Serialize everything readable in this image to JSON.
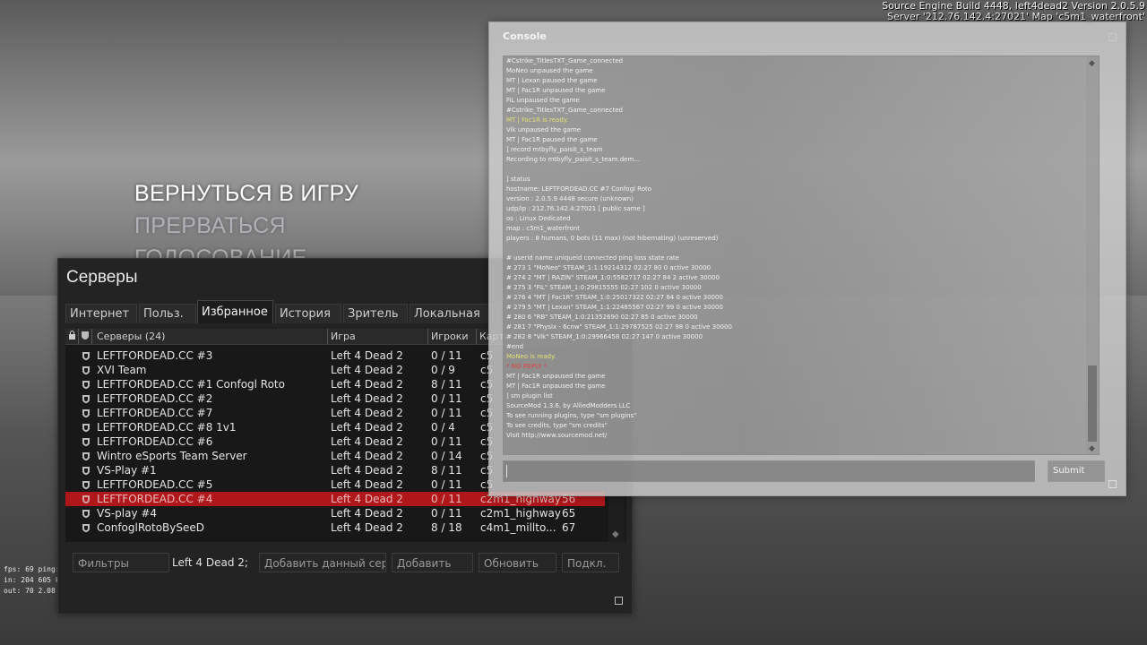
{
  "engine": {
    "build_line": "Source Engine Build 4448, left4dead2 Version 2.0.5.9",
    "server_line": "Server '212.76.142.4:27021' Map 'c5m1_waterfront'"
  },
  "main_menu": {
    "items": [
      "ВЕРНУТЬСЯ В ИГРУ",
      "ПРЕРВАТЬСЯ",
      "ГОЛОСОВАНИЕ"
    ]
  },
  "fps_overlay": [
    "fps: 69  ping: 0",
    "in: 204  605 k",
    "out: 70  2.08 k"
  ],
  "servers": {
    "title": "Серверы",
    "tabs": [
      "Интернет",
      "Польз.",
      "Избранное",
      "История",
      "Зритель",
      "Локальная сеть"
    ],
    "active_tab": "Избранное",
    "columns": {
      "name": "Серверы (24)",
      "game": "Игра",
      "players": "Игроки",
      "map": "Карта",
      "ping": ""
    },
    "rows": [
      {
        "name": "LEFTFORDEAD.CC #3",
        "game": "Left 4 Dead 2",
        "players": "0 / 11",
        "map": "c5",
        "ping": ""
      },
      {
        "name": "XVI Team",
        "game": "Left 4 Dead 2",
        "players": "0 / 9",
        "map": "c5",
        "ping": ""
      },
      {
        "name": "LEFTFORDEAD.CC #1 Confogl Roto",
        "game": "Left 4 Dead 2",
        "players": "8 / 11",
        "map": "c5",
        "ping": ""
      },
      {
        "name": "LEFTFORDEAD.CC #2",
        "game": "Left 4 Dead 2",
        "players": "0 / 11",
        "map": "c5",
        "ping": ""
      },
      {
        "name": "LEFTFORDEAD.CC #7",
        "game": "Left 4 Dead 2",
        "players": "0 / 11",
        "map": "c5",
        "ping": ""
      },
      {
        "name": "LEFTFORDEAD.CC #8 1v1",
        "game": "Left 4 Dead 2",
        "players": "0 / 4",
        "map": "c5",
        "ping": ""
      },
      {
        "name": "LEFTFORDEAD.CC #6",
        "game": "Left 4 Dead 2",
        "players": "0 / 11",
        "map": "c5",
        "ping": ""
      },
      {
        "name": "Wintro eSports Team Server",
        "game": "Left 4 Dead 2",
        "players": "0 / 14",
        "map": "c5",
        "ping": ""
      },
      {
        "name": "VS-Play #1",
        "game": "Left 4 Dead 2",
        "players": "8 / 11",
        "map": "c5",
        "ping": ""
      },
      {
        "name": "LEFTFORDEAD.CC #5",
        "game": "Left 4 Dead 2",
        "players": "0 / 11",
        "map": "c5",
        "ping": ""
      },
      {
        "name": "LEFTFORDEAD.CC #4",
        "game": "Left 4 Dead 2",
        "players": "0 / 11",
        "map": "c2m1_highway",
        "ping": "56",
        "selected": true
      },
      {
        "name": "VS-play #4",
        "game": "Left 4 Dead 2",
        "players": "0 / 11",
        "map": "c2m1_highway",
        "ping": "65"
      },
      {
        "name": "ConfoglRotoBySeeD",
        "game": "Left 4 Dead 2",
        "players": "8 / 18",
        "map": "c4m1_millto...",
        "ping": "67"
      }
    ],
    "bottom": {
      "filters": "Фильтры",
      "game_filter": "Left 4 Dead 2;",
      "add_current": "Добавить данный сер...",
      "add": "Добавить",
      "refresh": "Обновить",
      "connect": "Подкл."
    }
  },
  "console": {
    "title": "Console",
    "lines": [
      {
        "text": "#Cstrike_TitlesTXT_Game_connected",
        "color": "white"
      },
      {
        "text": "MoNeo unpaused the game",
        "color": "white"
      },
      {
        "text": "MT | Lexan paused the game",
        "color": "white"
      },
      {
        "text": "MT | Fac1R unpaused the game",
        "color": "white"
      },
      {
        "text": "FiL unpaused the game",
        "color": "white"
      },
      {
        "text": "#Cstrike_TitlesTXT_Game_connected",
        "color": "white"
      },
      {
        "text": "MT | Fac1R is ready.",
        "color": "yellow"
      },
      {
        "text": "Vik unpaused the game",
        "color": "white"
      },
      {
        "text": "MT | Fac1R paused the game",
        "color": "white"
      },
      {
        "text": "] record mtbyfly_paisit_s_team",
        "color": "white"
      },
      {
        "text": "Recording to mtbyfly_paisit_s_team.dem...",
        "color": "white"
      },
      {
        "text": "",
        "color": "white"
      },
      {
        "text": "] status",
        "color": "white"
      },
      {
        "text": "hostname: LEFTFORDEAD.CC #7 Confogl Roto",
        "color": "white"
      },
      {
        "text": "version : 2.0.5.9 4448 secure  (unknown)",
        "color": "white"
      },
      {
        "text": "udp/ip  : 212.76.142.4:27021 [ public same ]",
        "color": "white"
      },
      {
        "text": "os      :  Linux Dedicated",
        "color": "white"
      },
      {
        "text": "map     : c5m1_waterfront",
        "color": "white"
      },
      {
        "text": "players : 8 humans, 0 bots (11 max) (not hibernating) (unreserved)",
        "color": "white"
      },
      {
        "text": "",
        "color": "white"
      },
      {
        "text": "# userid name uniqueid connected ping loss state rate",
        "color": "white"
      },
      {
        "text": "# 273 1 \"MoNeo\" STEAM_1:1:19214312 02:27 80 0 active 30000",
        "color": "white"
      },
      {
        "text": "# 274 2 \"MT | RAZIN\" STEAM_1:0:5582717 02:27 84 2 active 30000",
        "color": "white"
      },
      {
        "text": "# 275 3 \"FiL\" STEAM_1:0:29815555 02:27 102 0 active 30000",
        "color": "white"
      },
      {
        "text": "# 276 4 \"MT | Fac1R\" STEAM_1:0:25017322 02:27 84 0 active 30000",
        "color": "white"
      },
      {
        "text": "# 279 5 \"MT | Lexan\" STEAM_1:1:22485567 02:27 99 0 active 30000",
        "color": "white"
      },
      {
        "text": "# 280 6 \"RB\" STEAM_1:0:21352690 02:27 85 0 active 30000",
        "color": "white"
      },
      {
        "text": "# 281 7 \"Physix - 6cnw\" STEAM_1:1:29787525 02:27 98 0 active 30000",
        "color": "white"
      },
      {
        "text": "# 282 8 \"Vik\" STEAM_1:0:29966458 02:27 147 0 active 30000",
        "color": "white"
      },
      {
        "text": "#end",
        "color": "white"
      },
      {
        "text": "MoNeo is ready.",
        "color": "yellow"
      },
      {
        "text": "* NO REPLY *",
        "color": "red"
      },
      {
        "text": "MT | Fac1R unpaused the game",
        "color": "white"
      },
      {
        "text": "MT | Fac1R unpaused the game",
        "color": "white"
      },
      {
        "text": "] sm plugin list",
        "color": "white"
      },
      {
        "text": "SourceMod 1.3.6, by AlliedModders LLC",
        "color": "white"
      },
      {
        "text": "To see running plugins, type \"sm plugins\"",
        "color": "white"
      },
      {
        "text": "To see credits, type \"sm credits\"",
        "color": "white"
      },
      {
        "text": "Visit http://www.sourcemod.net/",
        "color": "white"
      }
    ],
    "input_value": "",
    "submit_label": "Submit"
  },
  "colors": {
    "selected_row": "#b0171b",
    "console_yellow": "#e2e07a",
    "console_red": "#e24040"
  }
}
